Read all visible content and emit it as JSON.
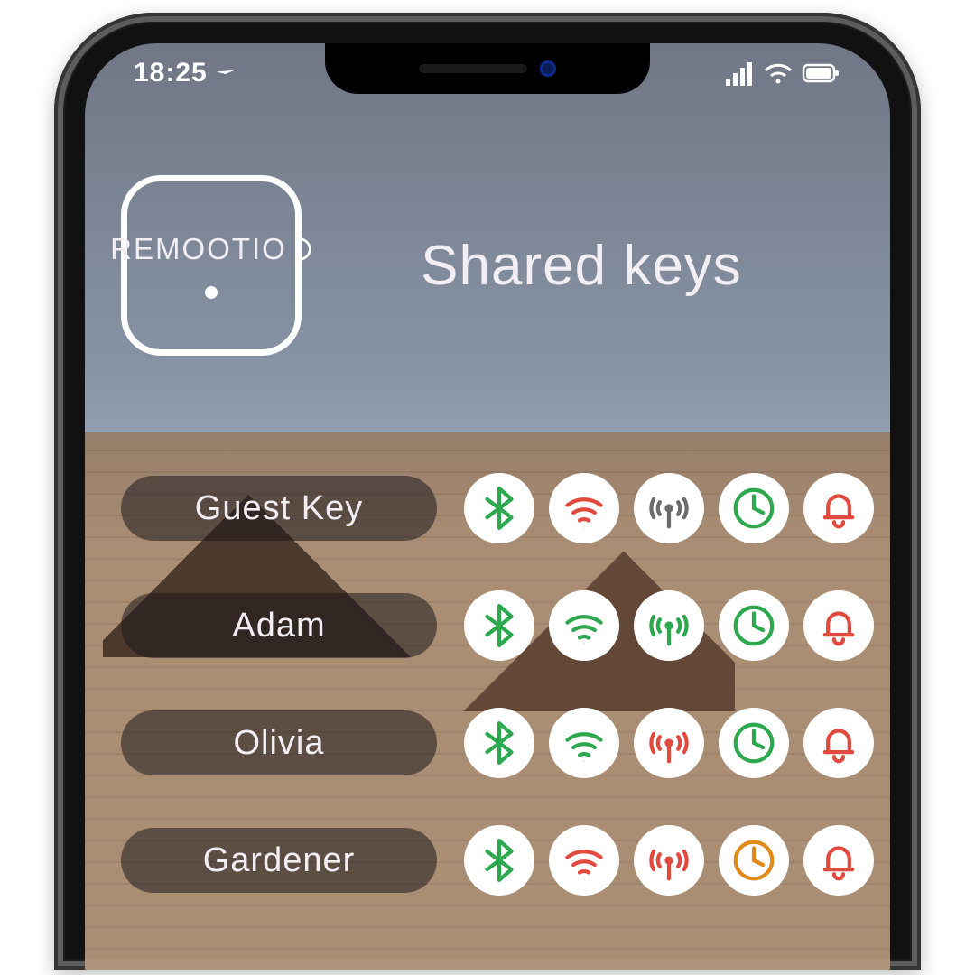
{
  "statusbar": {
    "time": "18:25"
  },
  "app": {
    "logo_label": "REMOOTIO",
    "page_title": "Shared keys"
  },
  "colors": {
    "green": "#2ea84f",
    "red": "#e14b3f",
    "gray": "#6b6b6b",
    "orange": "#e08a1c"
  },
  "keys": [
    {
      "name": "Guest Key",
      "status": {
        "bluetooth": "green",
        "wifi": "red",
        "broadcast": "gray",
        "clock": "green",
        "bell": "red"
      }
    },
    {
      "name": "Adam",
      "status": {
        "bluetooth": "green",
        "wifi": "green",
        "broadcast": "green",
        "clock": "green",
        "bell": "red"
      }
    },
    {
      "name": "Olivia",
      "status": {
        "bluetooth": "green",
        "wifi": "green",
        "broadcast": "red",
        "clock": "green",
        "bell": "red"
      }
    },
    {
      "name": "Gardener",
      "status": {
        "bluetooth": "green",
        "wifi": "red",
        "broadcast": "red",
        "clock": "orange",
        "bell": "red"
      }
    }
  ]
}
